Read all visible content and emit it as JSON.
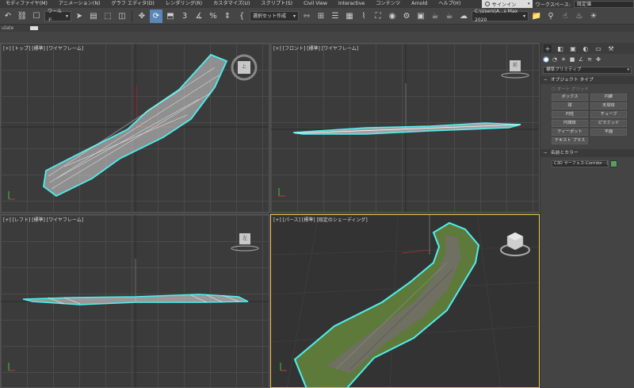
{
  "menubar": {
    "items": [
      "モディファイヤ(M)",
      "アニメーション(N)",
      "グラフ エディタ(D)",
      "レンダリング(R)",
      "カスタマイズ(U)",
      "スクリプト(S)",
      "Civil View",
      "Interactive",
      "コンテンツ",
      "Arnold",
      "ヘルプ(H)"
    ],
    "signin_label": "サインイン",
    "workspace_label": "ワークスペース:",
    "workspace_value": "既定値"
  },
  "toolbar": {
    "coord_dropdown": "ワールド",
    "selection_set_dropdown": "選択セット作成",
    "project_path": "C:\\Users\\A...s Max 2020"
  },
  "subrow": {
    "text": "ulate"
  },
  "viewports": {
    "top_label": "[+] [トップ] [標準] [ワイヤフレーム]",
    "front_label": "[+] [フロント] [標準] [ワイヤフレーム]",
    "left_label": "[+] [レフト] [標準] [ワイヤフレーム]",
    "persp_label": "[+] [パース] [標準] [既定のシェーディング]",
    "top_cube": "上",
    "front_cube": "前",
    "left_cube": "左"
  },
  "command_panel": {
    "category_dropdown": "標準プリミティブ",
    "object_type_header": "オブジェクト タイプ",
    "autogrid_label": "オート グリッド",
    "object_buttons": [
      "ボックス",
      "円錐",
      "球",
      "天球体",
      "円柱",
      "チューブ",
      "円環体",
      "ピラミッド",
      "ティーポット",
      "平面",
      "テキスト プラス"
    ],
    "name_color_header": "名前とカラー",
    "object_name": "C3D サーフェス-Corridor - (",
    "object_color": "#58a05a"
  },
  "colors": {
    "accent": "#5a87b8",
    "selection_wire": "#4ef0f0",
    "active_viewport_border": "#e8c84c",
    "surface_green": "#5d7a3a"
  }
}
